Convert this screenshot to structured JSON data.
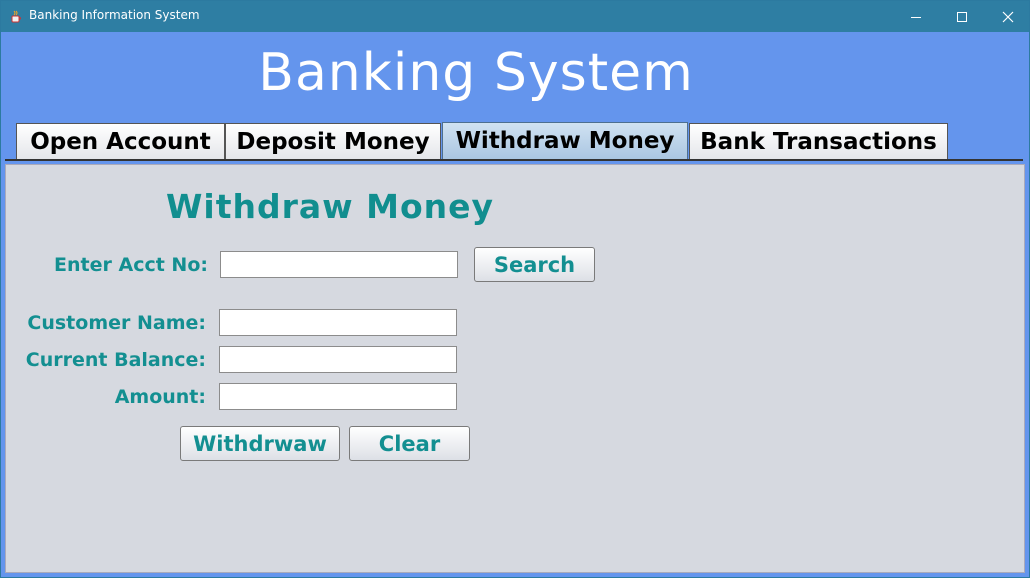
{
  "window": {
    "title": "Banking Information System",
    "icon": "java-cup-icon",
    "controls": [
      "minimize-icon",
      "maximize-icon",
      "close-icon"
    ]
  },
  "banner": {
    "title": "Banking System"
  },
  "tabs": [
    {
      "label": "Open Account"
    },
    {
      "label": "Deposit Money"
    },
    {
      "label": "Withdraw Money",
      "selected": true
    },
    {
      "label": "Bank Transactions"
    }
  ],
  "form": {
    "heading": "Withdraw Money",
    "acct_label": "Enter Acct No:",
    "acct_value": "",
    "search_label": "Search",
    "name_label": "Customer Name:",
    "name_value": "",
    "balance_label": "Current Balance:",
    "balance_value": "",
    "amount_label": "Amount:",
    "amount_value": "",
    "withdraw_label": "Withdrwaw",
    "clear_label": "Clear"
  },
  "colors": {
    "titlebar": "#2e7ea3",
    "window_bg": "#6495ed",
    "panel_bg": "#d6d9e0",
    "accent_text": "#138f91"
  }
}
